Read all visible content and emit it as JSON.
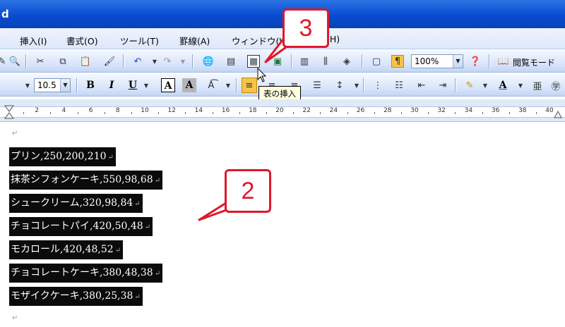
{
  "window": {
    "title_fragment": "d"
  },
  "menubar": {
    "items": [
      "挿入(I)",
      "書式(O)",
      "ツール(T)",
      "罫線(A)",
      "ウィンドウ(W)",
      "(H)"
    ]
  },
  "toolbar1": {
    "zoom_value": "100%",
    "reading_mode_label": "閲覧モード"
  },
  "toolbar2": {
    "font_size_value": "10.5",
    "bold_label": "B",
    "italic_label": "I",
    "underline_label": "U",
    "char_border_label": "A",
    "char_shading_label": "A",
    "font_color_label": "A"
  },
  "tooltip": {
    "text": "表の挿入"
  },
  "ruler": {
    "ticks": [
      "2",
      "4",
      "6",
      "8",
      "10",
      "12",
      "14",
      "16",
      "18",
      "20",
      "22",
      "24",
      "26",
      "28",
      "30",
      "32",
      "34",
      "36",
      "38",
      "40"
    ]
  },
  "document": {
    "lines": [
      "プリン,250,200,210",
      "抹茶シフォンケーキ,550,98,68",
      "シュークリーム,320,98,84",
      "チョコレートパイ,420,50,48",
      "モカロール,420,48,52",
      "チョコレートケーキ,380,48,38",
      "モザイクケーキ,380,25,38"
    ],
    "paragraph_mark": "↵"
  },
  "callouts": {
    "step2": "2",
    "step3": "3"
  },
  "colors": {
    "callout_red": "#e0172b",
    "titlebar_blue": "#0a4bd0",
    "selection_black": "#0b0b0b"
  }
}
